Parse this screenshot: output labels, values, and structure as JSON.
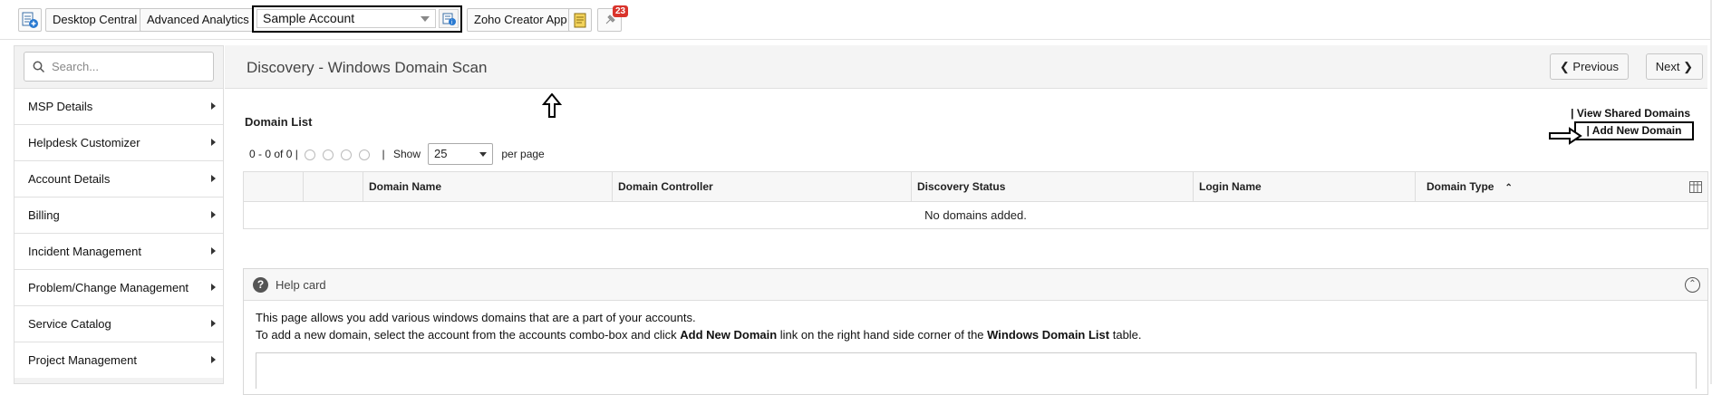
{
  "topbar": {
    "desktop_central": "Desktop Central",
    "advanced_analytics": "Advanced Analytics",
    "account_selected": "Sample Account",
    "zoho_creator": "Zoho Creator App",
    "notification_count": "23"
  },
  "sidebar": {
    "search_placeholder": "Search...",
    "items": [
      {
        "label": "MSP Details"
      },
      {
        "label": "Helpdesk Customizer"
      },
      {
        "label": "Account Details"
      },
      {
        "label": "Billing"
      },
      {
        "label": "Incident Management"
      },
      {
        "label": "Problem/Change Management"
      },
      {
        "label": "Service Catalog"
      },
      {
        "label": "Project Management"
      }
    ]
  },
  "page": {
    "title": "Discovery - Windows Domain Scan",
    "previous": "Previous",
    "next": "Next"
  },
  "domain_list": {
    "title": "Domain List",
    "view_shared": "|  View Shared Domains",
    "add_new": "|  Add New Domain",
    "pager_range": "0 - 0 of 0 |",
    "pager_sep": "|",
    "show_label": "Show",
    "per_page_value": "25",
    "per_page_label": "per page",
    "columns": [
      "Domain Name",
      "Domain Controller",
      "Discovery Status",
      "Login Name",
      "Domain Type"
    ],
    "empty_message": "No domains added."
  },
  "help": {
    "title": "Help card",
    "line1": "This page allows you add various windows domains that are a part of your accounts.",
    "line2_a": "To add a new domain, select the account from the accounts combo-box and click ",
    "line2_b": "Add New Domain",
    "line2_c": " link on the right hand side corner of the ",
    "line2_d": "Windows Domain List",
    "line2_e": " table."
  }
}
